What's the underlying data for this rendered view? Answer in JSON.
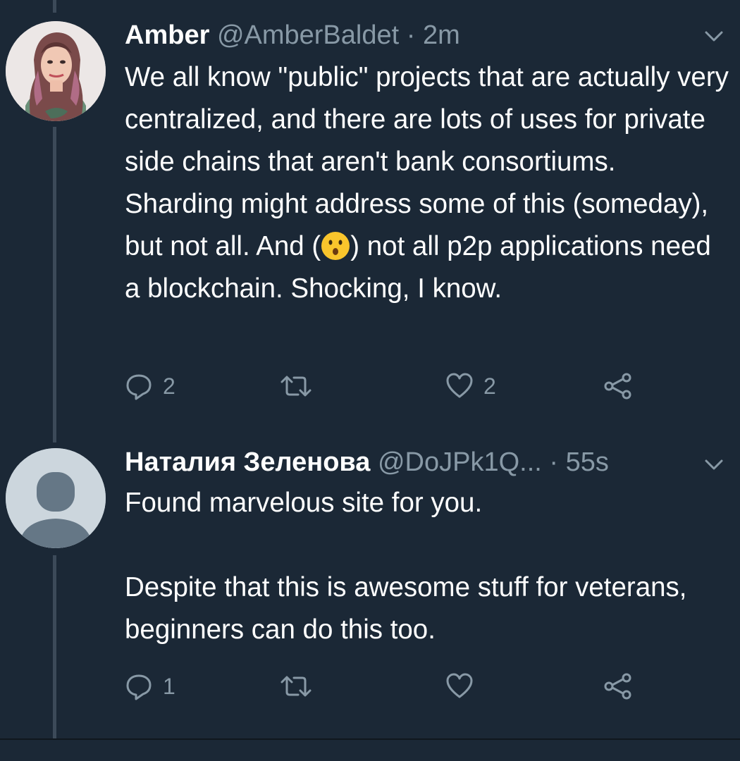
{
  "tweets": [
    {
      "name": "Amber",
      "handle": "@AmberBaldet",
      "separator": "·",
      "time": "2m",
      "text_pre": "We all know \"public\" projects that are actually very centralized, and there are lots of uses for private side chains that aren't bank consortiums. Sharding might address some of this (someday), but not all. And (",
      "text_post": ") not all p2p applications need a blockchain. Shocking, I know.",
      "reply_count": "2",
      "retweet_count": "",
      "like_count": "2"
    },
    {
      "name": "Наталия Зеленова",
      "handle": "@DoJPk1Q...",
      "separator": "·",
      "time": "55s",
      "text": "Found marvelous site for you.\n\nDespite that this is awesome stuff for veterans, beginners can do this too.",
      "reply_count": "1",
      "retweet_count": "",
      "like_count": ""
    }
  ],
  "colors": {
    "background": "#1b2836",
    "secondary_text": "#8899a6",
    "thread_line": "#3c4a59"
  }
}
